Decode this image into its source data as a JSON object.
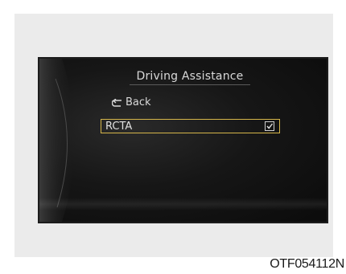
{
  "screen": {
    "title": "Driving Assistance",
    "back": {
      "icon": "return-arrow-icon",
      "label": "Back"
    },
    "options": [
      {
        "label": "RCTA",
        "checked": true,
        "selected": true
      }
    ],
    "highlight_color": "#d6b64a"
  },
  "caption": "OTF054112N"
}
